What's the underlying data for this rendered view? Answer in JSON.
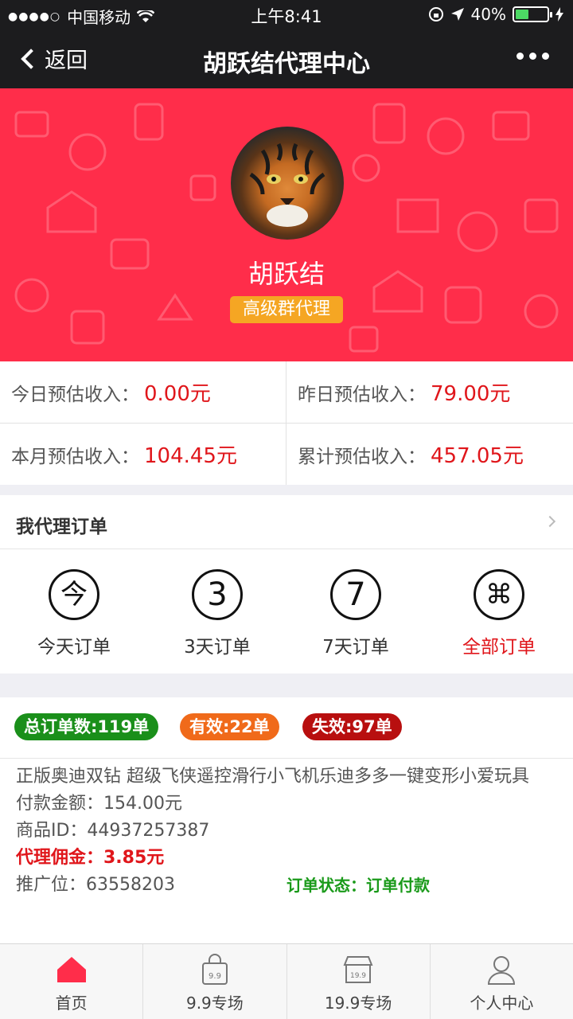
{
  "status": {
    "carrier": "中国移动",
    "time": "上午8:41",
    "battery": "40%"
  },
  "nav": {
    "back_label": "返回",
    "title": "胡跃结代理中心"
  },
  "profile": {
    "name": "胡跃结",
    "badge": "高级群代理"
  },
  "stats": [
    {
      "label": "今日预估收入：",
      "value": "0.00元"
    },
    {
      "label": "昨日预估收入：",
      "value": "79.00元"
    },
    {
      "label": "本月预估收入：",
      "value": "104.45元"
    },
    {
      "label": "累计预估收入：",
      "value": "457.05元"
    }
  ],
  "orders": {
    "title": "我代理订单",
    "tabs": [
      {
        "glyph": "今",
        "label": "今天订单"
      },
      {
        "glyph": "3",
        "label": "3天订单"
      },
      {
        "glyph": "7",
        "label": "7天订单"
      },
      {
        "glyph": "⌘",
        "label": "全部订单"
      }
    ]
  },
  "summary": {
    "total": "总订单数:119单",
    "valid": "有效:22单",
    "invalid": "失效:97单"
  },
  "order_item": {
    "name": "正版奥迪双钻 超级飞侠遥控滑行小飞机乐迪多多一键变形小爱玩具",
    "amount": "付款金额：154.00元",
    "product_id": "商品ID：44937257387",
    "commission": "代理佣金：3.85元",
    "position": "推广位：63558203",
    "status": "订单状态：订单付款"
  },
  "tabbar": [
    "首页",
    "9.9专场",
    "19.9专场",
    "个人中心"
  ],
  "colors": {
    "hero": "#ff2d4a",
    "accent": "#e0161b",
    "green": "#1a8f1a",
    "orange": "#f06a1a",
    "darkred": "#b80f0f",
    "badge": "#f5a623"
  }
}
